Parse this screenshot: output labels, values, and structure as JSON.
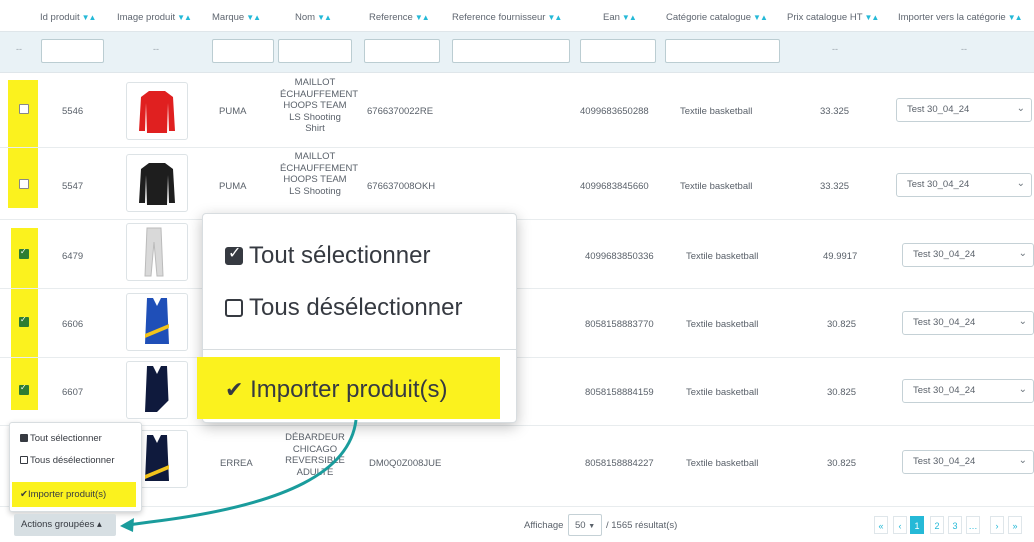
{
  "headers": [
    {
      "label": "Id produit"
    },
    {
      "label": "Image produit"
    },
    {
      "label": "Marque"
    },
    {
      "label": "Nom"
    },
    {
      "label": "Reference"
    },
    {
      "label": "Reference fournisseur"
    },
    {
      "label": "Ean"
    },
    {
      "label": "Catégorie catalogue"
    },
    {
      "label": "Prix catalogue HT"
    },
    {
      "label": "Importer vers la catégorie"
    }
  ],
  "sort_glyph": "▼▲",
  "filter_dash": "--",
  "rows": [
    {
      "id": "5546",
      "brand": "PUMA",
      "name": "MAILLOT ÉCHAUFFEMENT HOOPS TEAM LS Shooting Shirt",
      "ref": "6766370022RE",
      "ean": "4099683650288",
      "category": "Textile basketball",
      "price": "33.325",
      "import": "Test 30_04_24",
      "checked": false
    },
    {
      "id": "5547",
      "brand": "PUMA",
      "name": "MAILLOT ÉCHAUFFEMENT HOOPS TEAM LS Shooting",
      "ref": "676637008OKH",
      "ean": "4099683845660",
      "category": "Textile basketball",
      "price": "33.325",
      "import": "Test 30_04_24",
      "checked": false
    },
    {
      "id": "6479",
      "brand": "",
      "name": "",
      "ref": "",
      "ean": "4099683850336",
      "category": "Textile basketball",
      "price": "49.9917",
      "import": "Test 30_04_24",
      "checked": true
    },
    {
      "id": "6606",
      "brand": "",
      "name": "",
      "ref": "",
      "ean": "8058158883770",
      "category": "Textile basketball",
      "price": "30.825",
      "import": "Test 30_04_24",
      "checked": true
    },
    {
      "id": "6607",
      "brand": "",
      "name": "",
      "ref": "",
      "ean": "8058158884159",
      "category": "Textile basketball",
      "price": "30.825",
      "import": "Test 30_04_24",
      "checked": true
    },
    {
      "id": "",
      "brand": "ERREA",
      "name": "DÉBARDEUR CHICAGO REVERSIBLE ADULTE",
      "ref": "DM0Q0Z008JUE",
      "ean": "8058158884227",
      "category": "Textile basketball",
      "price": "30.825",
      "import": "Test 30_04_24",
      "checked": false
    }
  ],
  "popup": {
    "select_all": "Tout sélectionner",
    "deselect_all": "Tous désélectionner",
    "import": "Importer produit(s)"
  },
  "small_menu": {
    "select_all": "Tout sélectionner",
    "deselect_all": "Tous désélectionner",
    "import": "Importer produit(s)"
  },
  "footer": {
    "actions_button": "Actions groupées ▴",
    "display_label": "Affichage",
    "per_page": "50",
    "results": "/ 1565 résultat(s)",
    "pages": [
      "«",
      "‹",
      "1",
      "2",
      "3",
      "…",
      "›",
      "»"
    ],
    "active_page": "1"
  },
  "colors": {
    "accent": "#25b9d7",
    "highlight": "#fbf21e",
    "arrow": "#1a9c9c"
  },
  "icons": {
    "check": "check-icon",
    "chevron": "chevron-down-icon"
  }
}
